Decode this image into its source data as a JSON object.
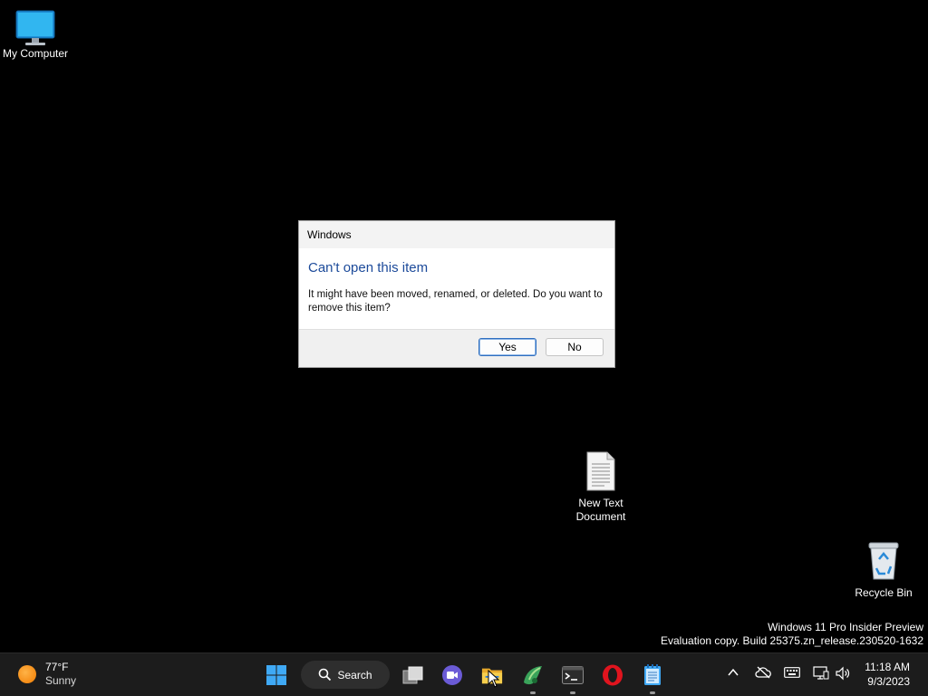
{
  "desktop": {
    "icons": [
      {
        "label": "My Computer"
      },
      {
        "label": "New Text\nDocument"
      },
      {
        "label": "Recycle Bin"
      }
    ]
  },
  "dialog": {
    "title": "Windows",
    "heading": "Can't open this item",
    "message": "It might have been moved, renamed, or deleted. Do you want to remove this item?",
    "yes_label": "Yes",
    "no_label": "No"
  },
  "watermark": {
    "line1": "Windows 11 Pro Insider Preview",
    "line2": "Evaluation copy. Build 25375.zn_release.230520-1632"
  },
  "taskbar": {
    "weather": {
      "temp": "77°F",
      "condition": "Sunny"
    },
    "search_label": "Search",
    "apps": [
      "start-icon",
      "task-view-icon",
      "meet-icon",
      "file-explorer-icon",
      "edge-beta-icon",
      "terminal-icon",
      "opera-icon",
      "notepad-icon"
    ],
    "clock": {
      "time": "11:18 AM",
      "date": "9/3/2023"
    }
  },
  "colors": {
    "dialog_heading": "#1c4a9a",
    "default_button_border": "#2f6fbf",
    "taskbar_bg": "#1c1c1c"
  }
}
